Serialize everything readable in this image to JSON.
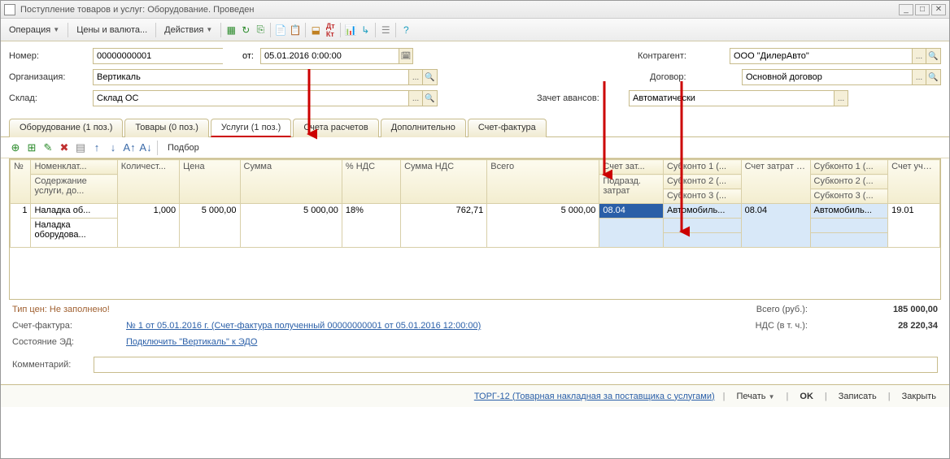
{
  "window": {
    "title": "Поступление товаров и услуг: Оборудование. Проведен"
  },
  "toolbar": {
    "operation": "Операция",
    "prices": "Цены и валюта...",
    "actions": "Действия"
  },
  "form": {
    "number_label": "Номер:",
    "number": "00000000001",
    "from_label": "от:",
    "from": "05.01.2016 0:00:00",
    "org_label": "Организация:",
    "org": "Вертикаль",
    "warehouse_label": "Склад:",
    "warehouse": "Склад ОС",
    "counterparty_label": "Контрагент:",
    "counterparty": "ООО \"ДилерАвто\"",
    "contract_label": "Договор:",
    "contract": "Основной договор",
    "advance_label": "Зачет авансов:",
    "advance": "Автоматически"
  },
  "tabs": {
    "equipment": "Оборудование (1 поз.)",
    "goods": "Товары (0 поз.)",
    "services": "Услуги (1 поз.)",
    "accounts": "Счета расчетов",
    "additional": "Дополнительно",
    "invoice": "Счет-фактура"
  },
  "sub": {
    "podborb": "Подбор"
  },
  "grid": {
    "h_num": "№",
    "h_nomen": "Номенклат...",
    "h_content": "Содержание услуги, до...",
    "h_qty": "Количест...",
    "h_price": "Цена",
    "h_sum": "Сумма",
    "h_vatpct": "% НДС",
    "h_vatsum": "Сумма НДС",
    "h_total": "Всего",
    "h_costacc": "Счет зат...",
    "h_div": "Подразд. затрат",
    "h_sub1": "Субконто 1 (...",
    "h_sub2": "Субконто 2 (...",
    "h_sub3": "Субконто 3 (...",
    "h_costacc_nu": "Счет затрат (НУ)",
    "h_sub1n": "Субконто 1 (...",
    "h_sub2n": "Субконто 2 (...",
    "h_sub3n": "Субконто 3 (...",
    "h_vatacc": "Счет учета НДС",
    "r1_num": "1",
    "r1_nomen": "Наладка об...",
    "r1_content": "Наладка оборудова...",
    "r1_qty": "1,000",
    "r1_price": "5 000,00",
    "r1_sum": "5 000,00",
    "r1_vatpct": "18%",
    "r1_vatsum": "762,71",
    "r1_total": "5 000,00",
    "r1_costacc": "08.04",
    "r1_sub1": "Автомобиль...",
    "r1_costacc_nu": "08.04",
    "r1_sub1n": "Автомобиль...",
    "r1_vatacc": "19.01"
  },
  "footer": {
    "pricetype": "Тип цен: Не заполнено!",
    "total_label": "Всего (руб.):",
    "total": "185 000,00",
    "invoice_label": "Счет-фактура:",
    "invoice_link": "№ 1 от 05.01.2016 г. (Счет-фактура полученный 00000000001 от 05.01.2016 12:00:00)",
    "vat_label": "НДС (в т. ч.):",
    "vat": "28 220,34",
    "ed_label": "Состояние ЭД:",
    "ed_link": "Подключить \"Вертикаль\" к ЭДО",
    "comment_label": "Комментарий:"
  },
  "bottom": {
    "torg": "ТОРГ-12 (Товарная накладная за поставщика с услугами)",
    "print": "Печать",
    "ok": "OK",
    "save": "Записать",
    "close": "Закрыть"
  }
}
